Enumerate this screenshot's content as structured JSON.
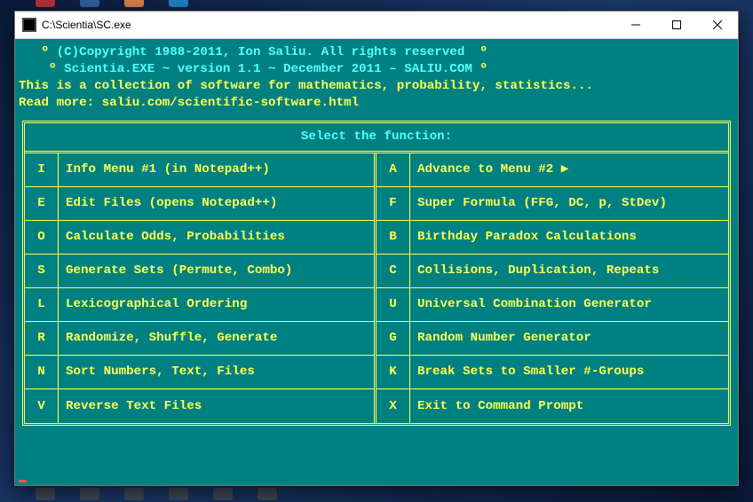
{
  "window": {
    "title": "C:\\Scientia\\SC.exe"
  },
  "header": {
    "line1_prefix": "   º ",
    "line1": "(C)Copyright 1988-2011, Ion Saliu. All rights reserved",
    "line1_suffix": "  º",
    "line2_prefix": "    º ",
    "line2": "Scientia.EXE ~ version 1.1 ~ December 2011 – SALIU.COM",
    "line2_suffix": " º",
    "line3": "This is a collection of software for mathematics, probability, statistics...",
    "line4": "Read more: saliu.com/scientific-software.html"
  },
  "menu": {
    "title": "Select the function:",
    "left": [
      {
        "key": "I",
        "label": "Info Menu #1 (in Notepad++)"
      },
      {
        "key": "E",
        "label": "Edit Files (opens Notepad++)"
      },
      {
        "key": "O",
        "label": "Calculate Odds, Probabilities"
      },
      {
        "key": "S",
        "label": "Generate Sets (Permute, Combo)"
      },
      {
        "key": "L",
        "label": "Lexicographical Ordering"
      },
      {
        "key": "R",
        "label": "Randomize, Shuffle, Generate"
      },
      {
        "key": "N",
        "label": "Sort Numbers, Text, Files"
      },
      {
        "key": "V",
        "label": "Reverse Text Files"
      }
    ],
    "right": [
      {
        "key": "A",
        "label": "Advance to Menu #2 ",
        "arrow": "▶"
      },
      {
        "key": "F",
        "label": "Super Formula (FFG, DC, p, StDev)"
      },
      {
        "key": "B",
        "label": "Birthday Paradox Calculations"
      },
      {
        "key": "C",
        "label": "Collisions, Duplication, Repeats"
      },
      {
        "key": "U",
        "label": "Universal Combination Generator"
      },
      {
        "key": "G",
        "label": "Random Number Generator"
      },
      {
        "key": "K",
        "label": "Break Sets to Smaller #-Groups"
      },
      {
        "key": "X",
        "label": "Exit to Command Prompt"
      }
    ]
  }
}
